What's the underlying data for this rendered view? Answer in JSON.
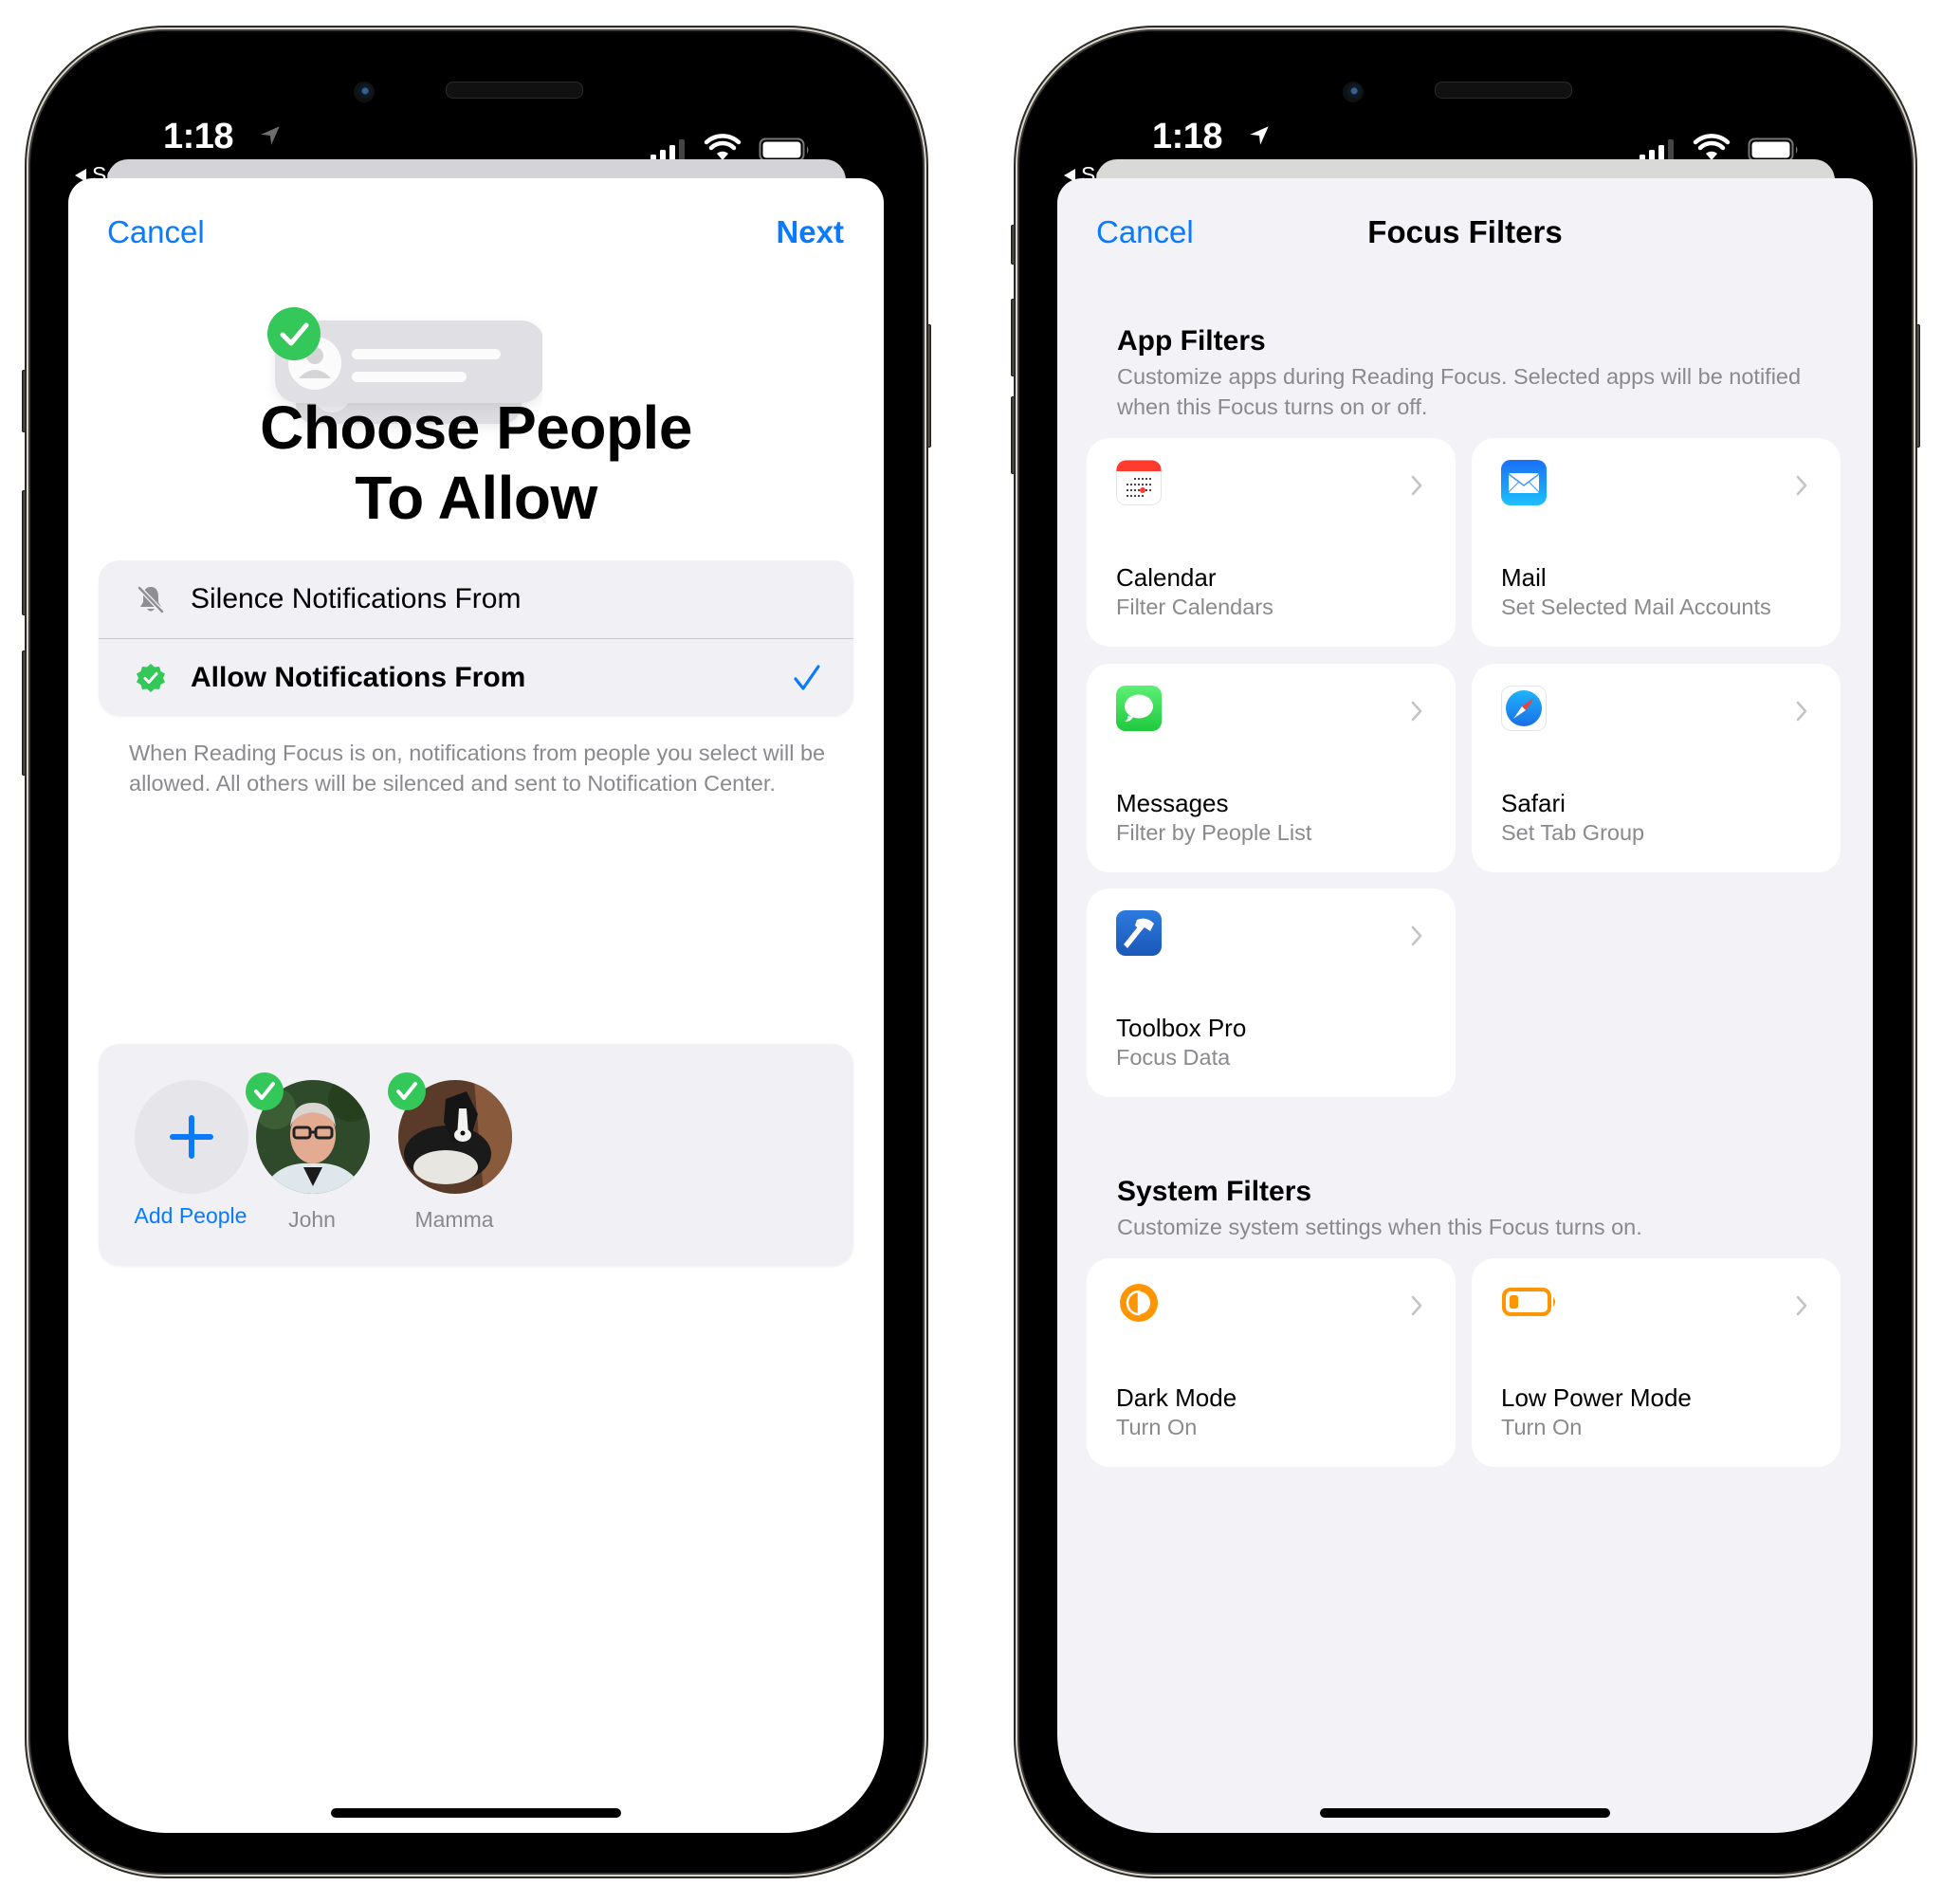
{
  "status_bar": {
    "time": "1:18",
    "back_label": "Search"
  },
  "left_screen": {
    "nav": {
      "cancel_label": "Cancel",
      "next_label": "Next"
    },
    "title_line1": "Choose People",
    "title_line2": "To Allow",
    "options": [
      {
        "label": "Silence Notifications From",
        "icon": "bell-slash-icon",
        "selected": false
      },
      {
        "label": "Allow Notifications From",
        "icon": "checkmark-seal-icon",
        "selected": true
      }
    ],
    "description": "When Reading Focus is on, notifications from people you select will be allowed. All others will be silenced and sent to Notification Center.",
    "people": {
      "add_label": "Add People",
      "contacts": [
        {
          "name": "John",
          "selected": true
        },
        {
          "name": "Mamma",
          "selected": true
        }
      ]
    }
  },
  "right_screen": {
    "nav": {
      "cancel_label": "Cancel",
      "title": "Focus Filters"
    },
    "app_filters": {
      "title": "App Filters",
      "description": "Customize apps during Reading Focus. Selected apps will be notified when this Focus turns on or off.",
      "cards": [
        {
          "title": "Calendar",
          "subtitle": "Filter Calendars",
          "icon": "calendar-icon"
        },
        {
          "title": "Mail",
          "subtitle": "Set Selected Mail Accounts",
          "icon": "mail-icon"
        },
        {
          "title": "Messages",
          "subtitle": "Filter by People List",
          "icon": "messages-icon"
        },
        {
          "title": "Safari",
          "subtitle": "Set Tab Group",
          "icon": "safari-icon"
        },
        {
          "title": "Toolbox Pro",
          "subtitle": "Focus Data",
          "icon": "toolbox-pro-icon"
        }
      ]
    },
    "system_filters": {
      "title": "System Filters",
      "description": "Customize system settings when this Focus turns on.",
      "cards": [
        {
          "title": "Dark Mode",
          "subtitle": "Turn On",
          "icon": "dark-mode-icon"
        },
        {
          "title": "Low Power Mode",
          "subtitle": "Turn On",
          "icon": "low-power-battery-icon"
        }
      ]
    }
  },
  "colors": {
    "accent_blue": "#0a7aff",
    "green": "#34c759",
    "orange": "#ff9500",
    "grouped_background": "#f2f2f7",
    "secondary_text": "#8a8a8e"
  }
}
